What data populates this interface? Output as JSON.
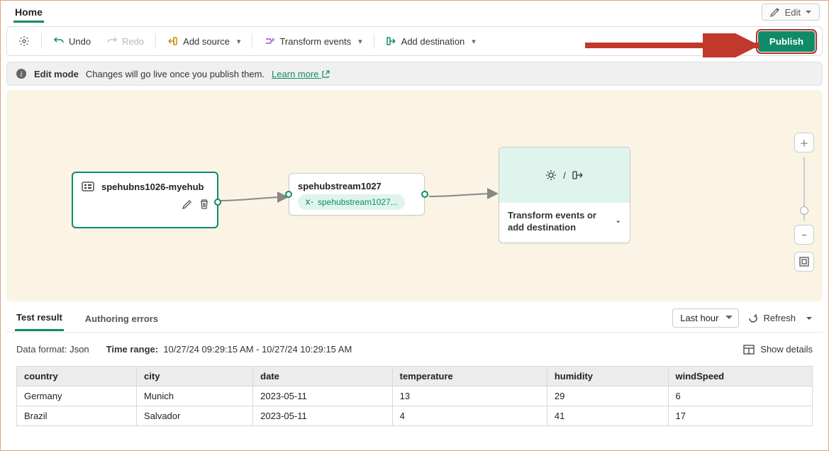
{
  "header": {
    "tab": "Home",
    "edit": "Edit"
  },
  "toolbar": {
    "undo": "Undo",
    "redo": "Redo",
    "add_source": "Add source",
    "transform": "Transform events",
    "add_destination": "Add destination",
    "publish": "Publish"
  },
  "info": {
    "mode": "Edit mode",
    "text": "Changes will go live once you publish them.",
    "learn": "Learn more"
  },
  "canvas": {
    "source": {
      "title": "spehubns1026-myehub"
    },
    "stream": {
      "title": "spehubstream1027",
      "chip": "spehubstream1027..."
    },
    "dest": {
      "title": "Transform events or add destination"
    }
  },
  "results": {
    "tabs": {
      "test": "Test result",
      "errors": "Authoring errors"
    },
    "range_select": "Last hour",
    "refresh": "Refresh",
    "meta": {
      "format_label": "Data format:",
      "format_value": "Json",
      "time_label": "Time range:",
      "time_value": "10/27/24 09:29:15 AM - 10/27/24 10:29:15 AM",
      "details": "Show details"
    },
    "columns": [
      "country",
      "city",
      "date",
      "temperature",
      "humidity",
      "windSpeed"
    ],
    "rows": [
      {
        "country": "Germany",
        "city": "Munich",
        "date": "2023-05-11",
        "temperature": "13",
        "humidity": "29",
        "windSpeed": "6"
      },
      {
        "country": "Brazil",
        "city": "Salvador",
        "date": "2023-05-11",
        "temperature": "4",
        "humidity": "41",
        "windSpeed": "17"
      }
    ]
  }
}
